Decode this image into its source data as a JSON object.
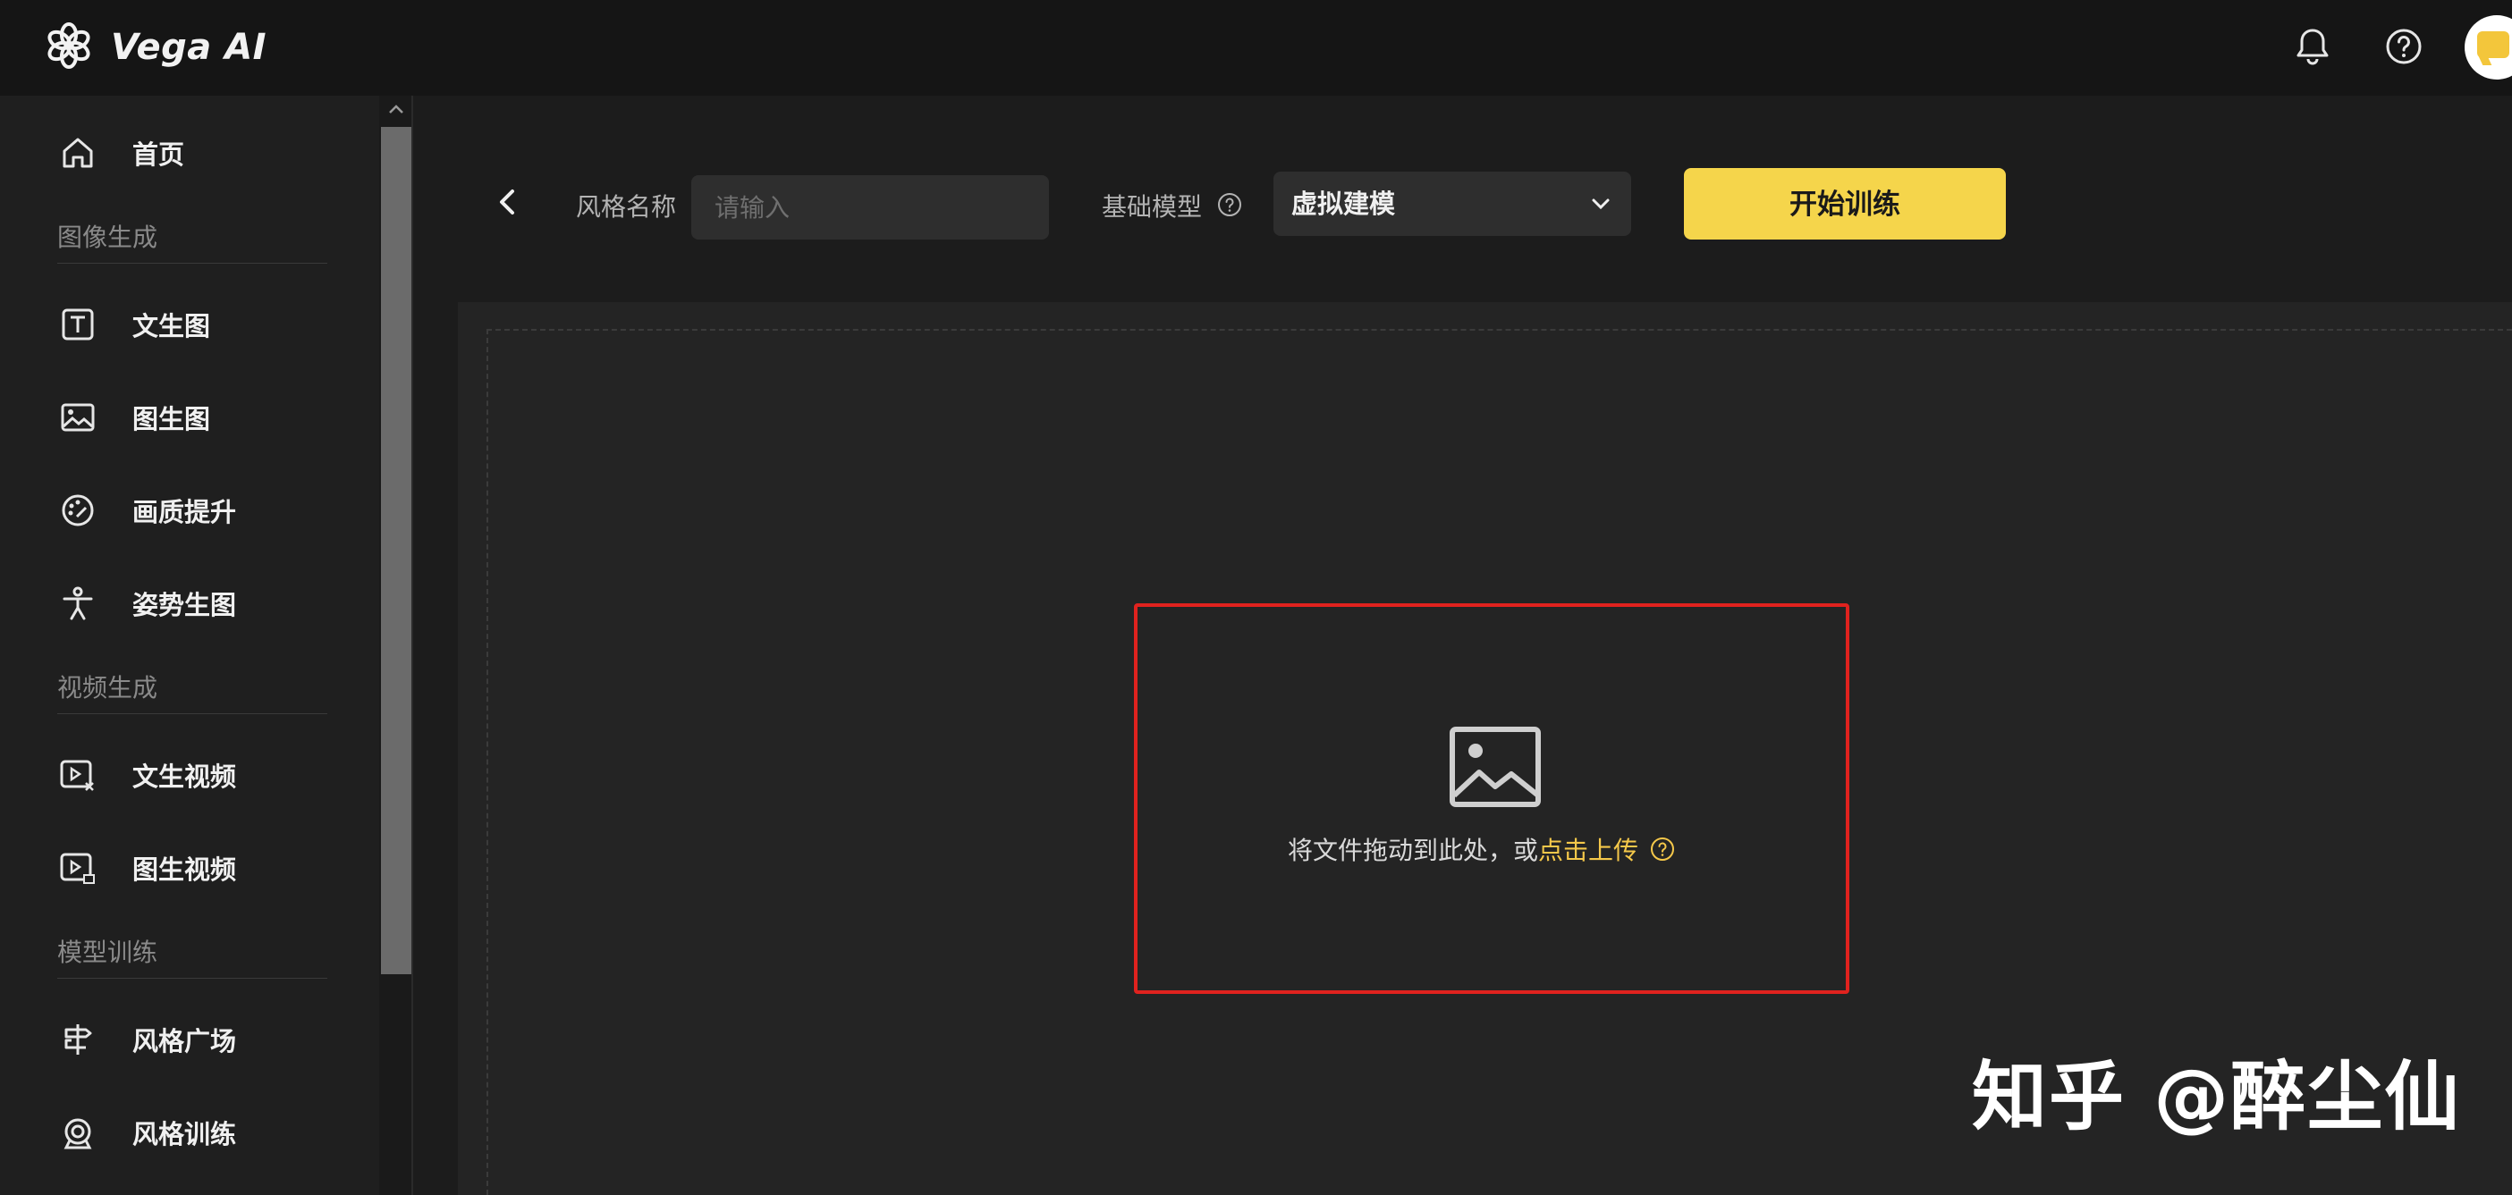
{
  "app": {
    "name": "Vega AI"
  },
  "sidebar": {
    "home_label": "首页",
    "sections": [
      {
        "title": "图像生成",
        "items": [
          "文生图",
          "图生图",
          "画质提升",
          "姿势生图"
        ]
      },
      {
        "title": "视频生成",
        "items": [
          "文生视频",
          "图生视频"
        ]
      },
      {
        "title": "模型训练",
        "items": [
          "风格广场",
          "风格训练"
        ]
      }
    ]
  },
  "form": {
    "style_name_label": "风格名称",
    "style_name_placeholder": "请输入",
    "base_model_label": "基础模型",
    "base_model_value": "虚拟建模",
    "start_button": "开始训练"
  },
  "upload": {
    "text": "将文件拖动到此处，或",
    "link": "点击上传"
  },
  "watermark": "知乎 @醉尘仙",
  "colors": {
    "accent": "#f5d54b",
    "highlight": "#e0221e",
    "link": "#f5c84a"
  }
}
